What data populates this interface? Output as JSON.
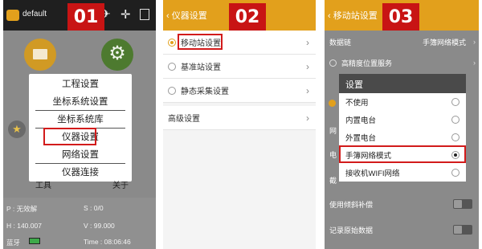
{
  "panel1": {
    "badge": "01",
    "title": "default",
    "menu_items": [
      "工程设置",
      "坐标系统设置",
      "坐标系统库",
      "仪器设置",
      "网络设置",
      "仪器连接"
    ],
    "highlighted_item": "仪器设置",
    "under_labels": [
      "工具",
      "关于"
    ],
    "status": {
      "p_label": "P : 无效解",
      "s_label": "S : 0/0",
      "h_label": "H : 140.007",
      "v_label": "V : 99.000",
      "bt_label": "蓝牙",
      "time_label": "Time : 08:06:46"
    }
  },
  "panel2": {
    "badge": "02",
    "back_label": "‹ 仪器设置",
    "rows": [
      {
        "label": "移动站设置",
        "selected": true
      },
      {
        "label": "基准站设置",
        "selected": false
      },
      {
        "label": "静态采集设置",
        "selected": false
      },
      {
        "label": "高级设置",
        "selected": false
      }
    ],
    "highlighted_row": "移动站设置"
  },
  "panel3": {
    "badge": "03",
    "back_label": "‹ 移动站设置",
    "datalink_label": "数据链",
    "datalink_value": "手簿网络模式",
    "hp_service": "高精度位置服务",
    "dialog": {
      "title": "设置",
      "options": [
        {
          "label": "不使用",
          "selected": false
        },
        {
          "label": "内置电台",
          "selected": false
        },
        {
          "label": "外置电台",
          "selected": false
        },
        {
          "label": "手簿网络模式",
          "selected": true
        },
        {
          "label": "接收机WIFI网络",
          "selected": false
        }
      ]
    },
    "partial_labels": [
      "网",
      "电",
      "截"
    ],
    "tilt_label": "使用倾斜补偿",
    "raw_label": "记录原始数据"
  },
  "colors": {
    "accent": "#e2a01c",
    "badge": "#c81414",
    "highlight": "#d21b1b"
  }
}
